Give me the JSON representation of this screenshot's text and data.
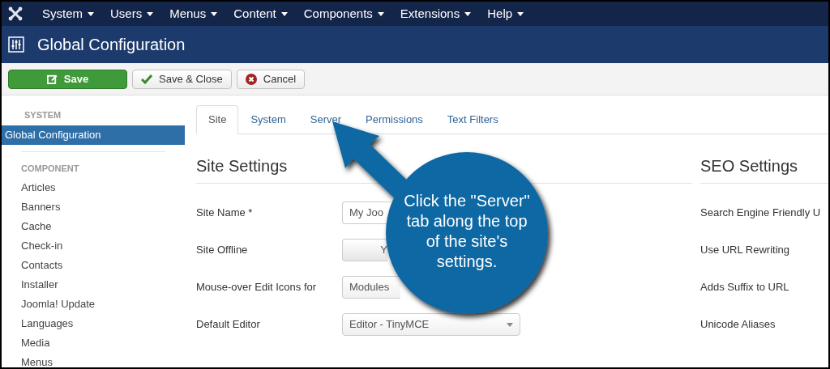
{
  "menu_bar": {
    "items": [
      "System",
      "Users",
      "Menus",
      "Content",
      "Components",
      "Extensions",
      "Help"
    ]
  },
  "header": {
    "title": "Global Configuration"
  },
  "toolbar": {
    "buttons": [
      {
        "kind": "save",
        "label": "Save"
      },
      {
        "kind": "save_close",
        "label": "Save & Close"
      },
      {
        "kind": "cancel",
        "label": "Cancel"
      }
    ]
  },
  "sidebar": {
    "sections": [
      {
        "heading": "SYSTEM",
        "items": [
          {
            "label": "Global Configuration",
            "selected": true
          }
        ]
      },
      {
        "heading": "COMPONENT",
        "items": [
          {
            "label": "Articles",
            "selected": false
          },
          {
            "label": "Banners",
            "selected": false
          },
          {
            "label": "Cache",
            "selected": false
          },
          {
            "label": "Check-in",
            "selected": false
          },
          {
            "label": "Contacts",
            "selected": false
          },
          {
            "label": "Installer",
            "selected": false
          },
          {
            "label": "Joomla! Update",
            "selected": false
          },
          {
            "label": "Languages",
            "selected": false
          },
          {
            "label": "Media",
            "selected": false
          },
          {
            "label": "Menus",
            "selected": false
          }
        ]
      }
    ]
  },
  "tabs": [
    {
      "label": "Site",
      "selected": true
    },
    {
      "label": "System",
      "selected": false
    },
    {
      "label": "Server",
      "selected": false
    },
    {
      "label": "Permissions",
      "selected": false
    },
    {
      "label": "Text Filters",
      "selected": false
    }
  ],
  "site_settings": {
    "heading": "Site Settings",
    "fields": [
      {
        "label": "Site Name *",
        "kind": "text",
        "value": "My Joo"
      },
      {
        "label": "Site Offline",
        "kind": "toggle",
        "value": "Y"
      },
      {
        "label": "Mouse-over Edit Icons for",
        "kind": "select",
        "value": "Modules"
      },
      {
        "label": "Default Editor",
        "kind": "select",
        "value": "Editor - TinyMCE"
      }
    ]
  },
  "seo_settings": {
    "heading": "SEO Settings",
    "fields": [
      "Search Engine Friendly U",
      "Use URL Rewriting",
      "Adds Suffix to URL",
      "Unicode Aliases"
    ]
  },
  "callout": {
    "text": "Click the \"Server\" tab along the top of the site's settings."
  }
}
